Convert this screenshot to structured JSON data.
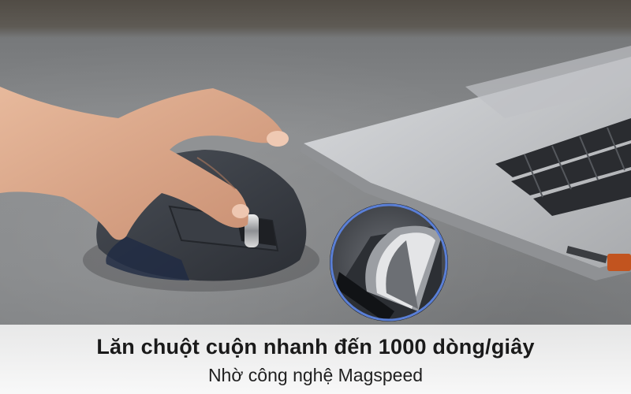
{
  "caption": {
    "title": "Lăn chuột cuộn nhanh đến 1000 dòng/giây",
    "subtitle": "Nhờ công nghệ Magspeed"
  },
  "colors": {
    "caption_background": "#f5f5f5",
    "caption_text": "#1a1a1a",
    "table_surface": "#808284",
    "laptop_body": "#c7c9cc",
    "mouse_body": "#3d4148",
    "zoom_ring": "#5a7fd6"
  },
  "icons": {
    "mouse": "wireless-mouse-icon",
    "scroll_wheel_zoom": "magnified-scroll-wheel-icon"
  }
}
